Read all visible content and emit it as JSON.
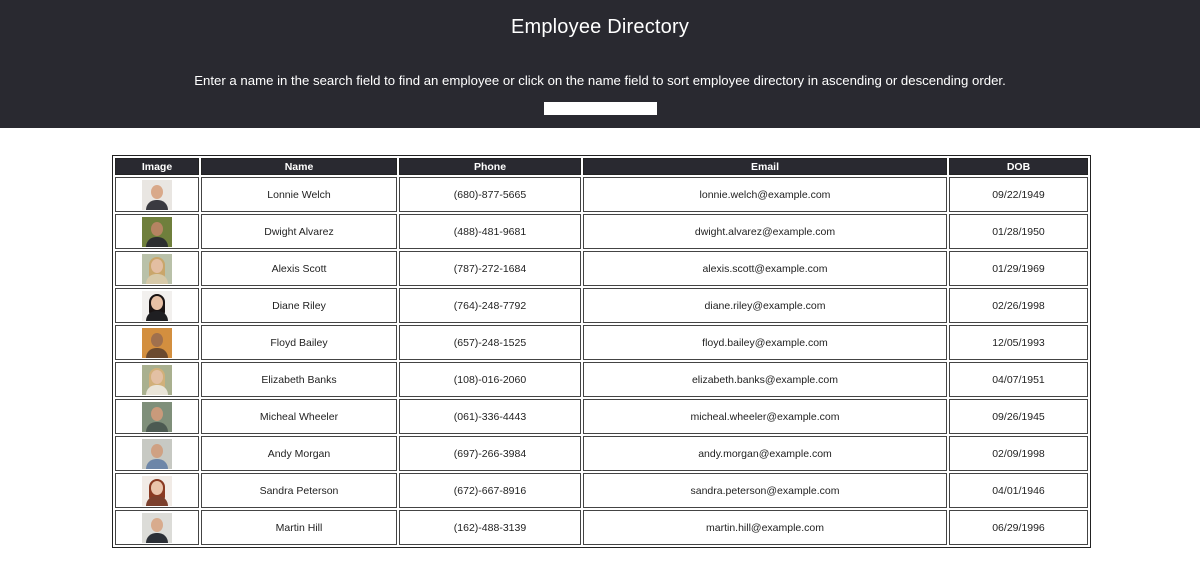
{
  "header": {
    "title": "Employee Directory",
    "instructions": "Enter a name in the search field to find an employee or click on the name field to sort employee directory in ascending or descending order.",
    "search_value": ""
  },
  "table": {
    "columns": [
      "Image",
      "Name",
      "Phone",
      "Email",
      "DOB"
    ],
    "rows": [
      {
        "name": "Lonnie Welch",
        "phone": "(680)-877-5665",
        "email": "lonnie.welch@example.com",
        "dob": "09/22/1949",
        "avatar": {
          "bg": "#e9e6e2",
          "skin": "#d9a98a",
          "shirt": "#3a3a40",
          "hair": "none"
        }
      },
      {
        "name": "Dwight Alvarez",
        "phone": "(488)-481-9681",
        "email": "dwight.alvarez@example.com",
        "dob": "01/28/1950",
        "avatar": {
          "bg": "#6f7f3c",
          "skin": "#b58462",
          "shirt": "#2c2e30",
          "hair": "none"
        }
      },
      {
        "name": "Alexis Scott",
        "phone": "(787)-272-1684",
        "email": "alexis.scott@example.com",
        "dob": "01/29/1969",
        "avatar": {
          "bg": "#b9c1a9",
          "skin": "#e3bea2",
          "shirt": "#d7c9a8",
          "hair": "#c9a66b"
        }
      },
      {
        "name": "Diane Riley",
        "phone": "(764)-248-7792",
        "email": "diane.riley@example.com",
        "dob": "02/26/1998",
        "avatar": {
          "bg": "#f2f0ee",
          "skin": "#e7c1a6",
          "shirt": "#1f1f22",
          "hair": "#1a1414"
        }
      },
      {
        "name": "Floyd Bailey",
        "phone": "(657)-248-1525",
        "email": "floyd.bailey@example.com",
        "dob": "12/05/1993",
        "avatar": {
          "bg": "#d38f3f",
          "skin": "#a0704d",
          "shirt": "#6b4a2f",
          "hair": "none"
        }
      },
      {
        "name": "Elizabeth Banks",
        "phone": "(108)-016-2060",
        "email": "elizabeth.banks@example.com",
        "dob": "04/07/1951",
        "avatar": {
          "bg": "#a9b08f",
          "skin": "#e3c0a4",
          "shirt": "#e9e4d8",
          "hair": "#d1b07a"
        }
      },
      {
        "name": "Micheal Wheeler",
        "phone": "(061)-336-4443",
        "email": "micheal.wheeler@example.com",
        "dob": "09/26/1945",
        "avatar": {
          "bg": "#7f8f7a",
          "skin": "#c99a7b",
          "shirt": "#4c5a52",
          "hair": "none"
        }
      },
      {
        "name": "Andy Morgan",
        "phone": "(697)-266-3984",
        "email": "andy.morgan@example.com",
        "dob": "02/09/1998",
        "avatar": {
          "bg": "#c7c9c3",
          "skin": "#cfa183",
          "shirt": "#6d86a8",
          "hair": "none"
        }
      },
      {
        "name": "Sandra Peterson",
        "phone": "(672)-667-8916",
        "email": "sandra.peterson@example.com",
        "dob": "04/01/1946",
        "avatar": {
          "bg": "#f1ebe6",
          "skin": "#eac4ab",
          "shirt": "#7b3f2c",
          "hair": "#8a3a22"
        }
      },
      {
        "name": "Martin Hill",
        "phone": "(162)-488-3139",
        "email": "martin.hill@example.com",
        "dob": "06/29/1996",
        "avatar": {
          "bg": "#dcdcd8",
          "skin": "#d8ab8d",
          "shirt": "#2b2f36",
          "hair": "none"
        }
      }
    ]
  }
}
